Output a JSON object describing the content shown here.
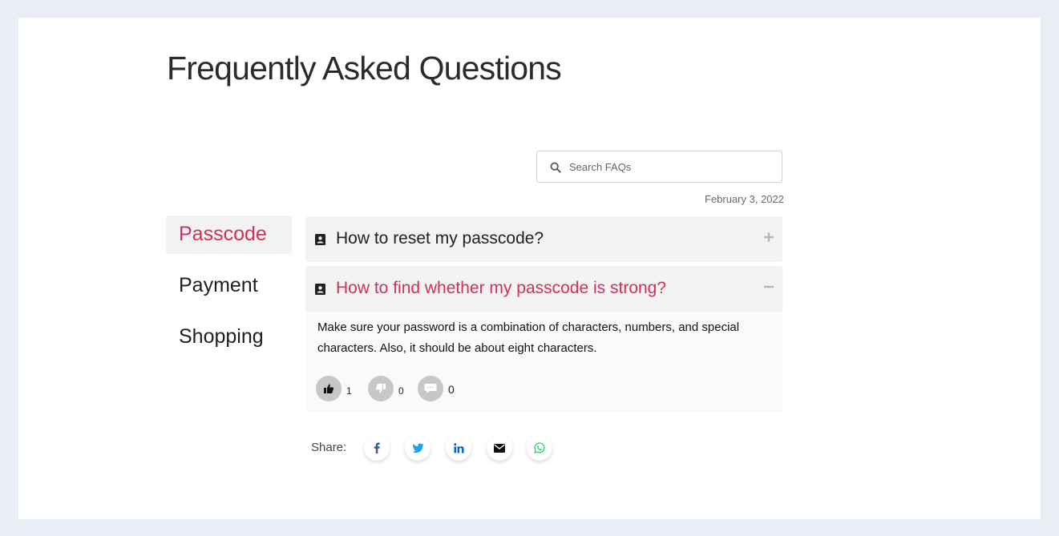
{
  "page": {
    "title": "Frequently Asked Questions"
  },
  "search": {
    "placeholder": "Search FAQs",
    "value": ""
  },
  "date": "February 3, 2022",
  "categories": [
    {
      "label": "Passcode",
      "active": true
    },
    {
      "label": "Payment",
      "active": false
    },
    {
      "label": "Shopping",
      "active": false
    }
  ],
  "faqs": [
    {
      "question": "How to reset my passcode?",
      "expanded": false
    },
    {
      "question": "How to find whether my passcode is strong?",
      "expanded": true,
      "answer": "Make sure your password is a combination of characters, numbers, and special characters. Also, it should be about eight characters.",
      "likes": "1",
      "dislikes": "0",
      "comments": "0"
    }
  ],
  "share": {
    "label": "Share:",
    "networks": [
      "facebook-icon",
      "twitter-icon",
      "linkedin-icon",
      "email-icon",
      "whatsapp-icon"
    ]
  },
  "colors": {
    "accent": "#d0315a",
    "facebook": "#3b5998",
    "twitter": "#1da1f2",
    "linkedin": "#0a66c2",
    "email": "#111111",
    "whatsapp": "#25d366"
  }
}
